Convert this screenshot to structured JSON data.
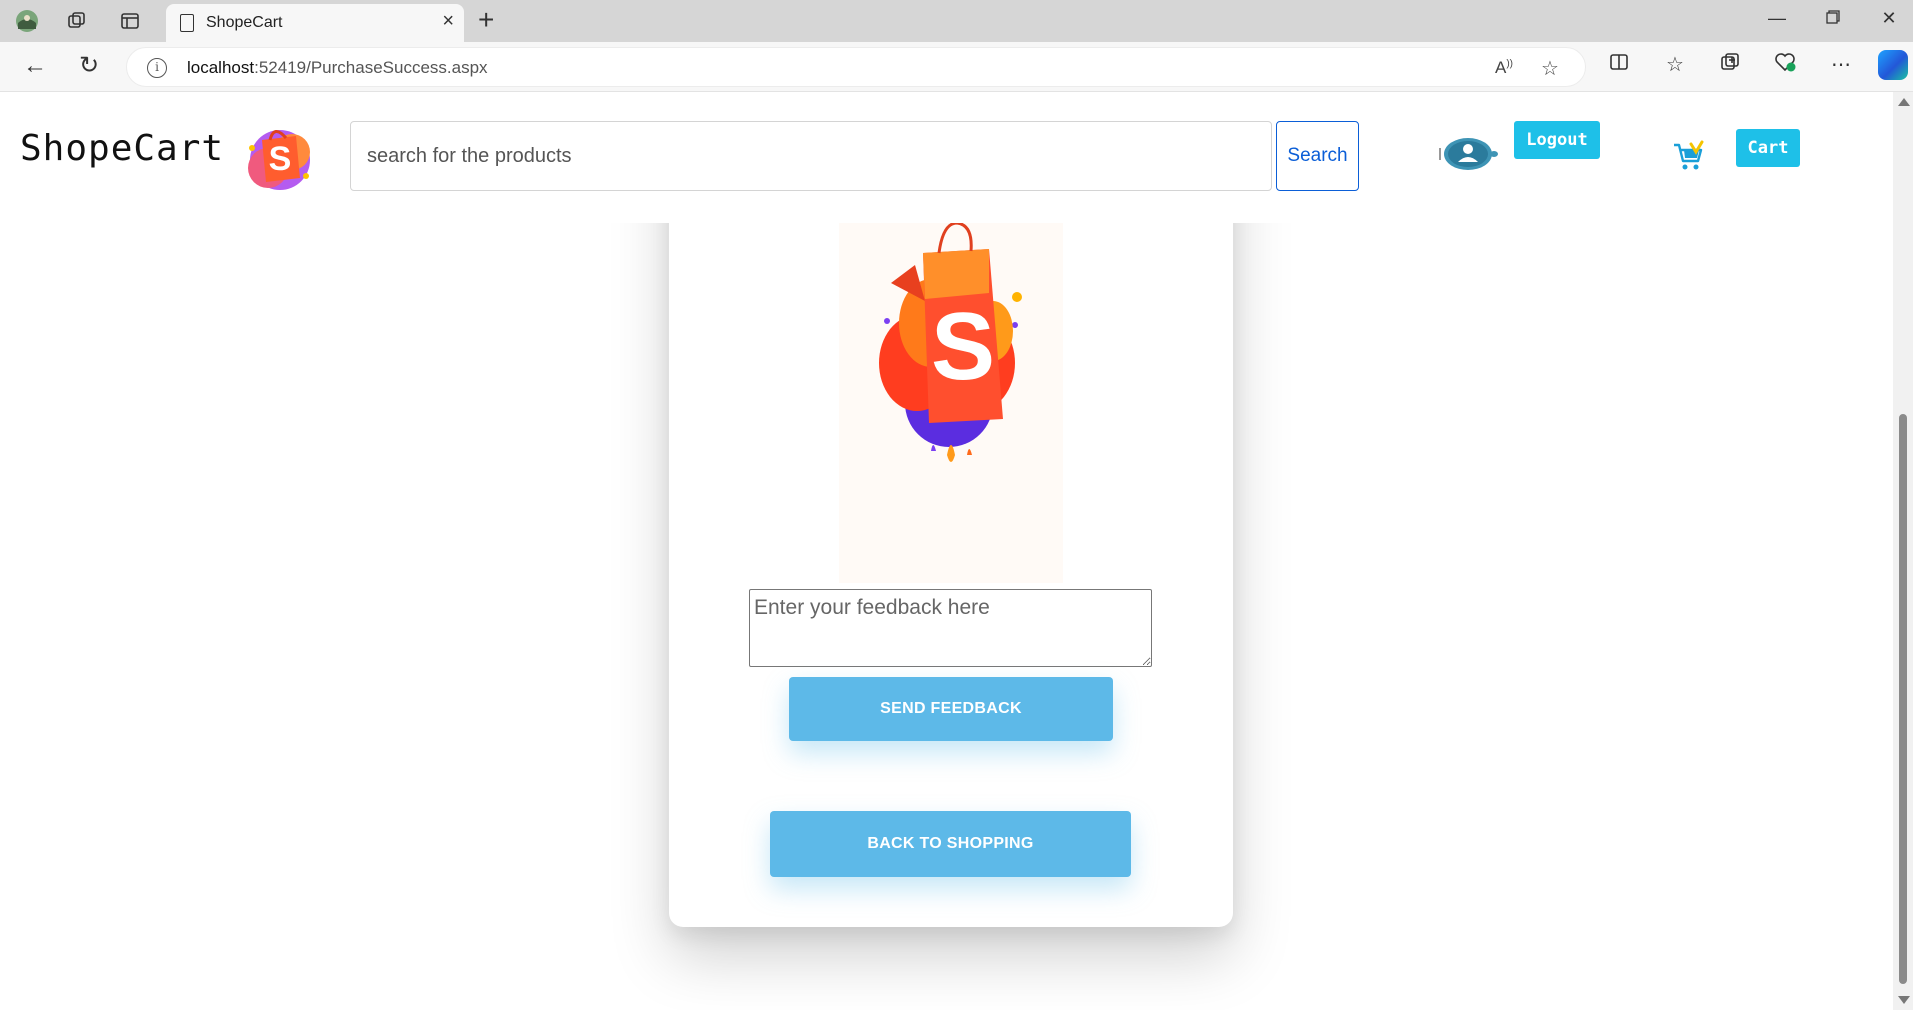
{
  "browser": {
    "tab_title": "ShopeCart",
    "tab_close": "×",
    "new_tab": "+",
    "url_host": "localhost",
    "url_rest": ":52419/PurchaseSuccess.aspx",
    "icons": [
      "workspaces-icon",
      "tab-actions-icon",
      "vertical-tabs-icon",
      "back-icon",
      "refresh-icon",
      "site-info-icon",
      "read-aloud-icon",
      "favorite-star-icon",
      "split-screen-icon",
      "favorites-icon",
      "collections-icon",
      "browser-essentials-icon",
      "more-icon",
      "copilot-icon",
      "minimize-icon",
      "restore-icon",
      "close-window-icon"
    ]
  },
  "header": {
    "brand": "ShopeCart",
    "search_placeholder": "search for the products",
    "search_button": "Search",
    "logout_button": "Logout",
    "cart_button": "Cart"
  },
  "card": {
    "feedback_placeholder": "Enter your feedback here",
    "send_feedback_button": "SEND FEEDBACK",
    "back_button": "BACK TO SHOPPING"
  },
  "colors": {
    "accent_button": "#1ec0e8",
    "primary_button": "#5db9e8",
    "search_blue": "#0b5ed7"
  }
}
